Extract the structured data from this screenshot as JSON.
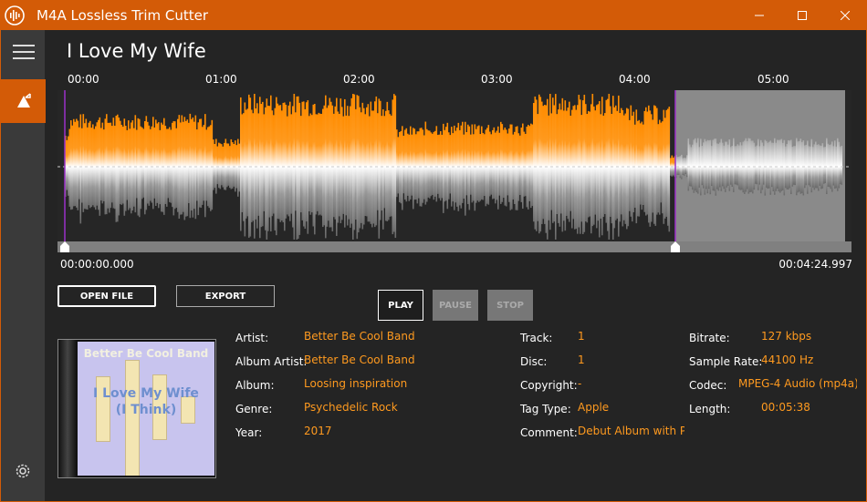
{
  "window": {
    "title": "M4A Lossless Trim Cutter",
    "minimize": "—",
    "maximize": "☐",
    "close": "✕"
  },
  "track": {
    "title": "I Love My Wife"
  },
  "timeline": {
    "ticks": [
      "00:00",
      "01:00",
      "02:00",
      "03:00",
      "04:00",
      "05:00"
    ]
  },
  "selection": {
    "start": "00:00:00.000",
    "end": "00:04:24.997"
  },
  "buttons": {
    "open_file": "OPEN FILE",
    "export": "EXPORT",
    "play": "PLAY",
    "pause": "PAUSE",
    "stop": "STOP"
  },
  "album_art": {
    "band": "Better Be Cool Band",
    "title_line1": "I Love My Wife",
    "title_line2": "(I Think)"
  },
  "metadata": {
    "col1": [
      {
        "label": "Artist:",
        "value": "Better Be Cool Band"
      },
      {
        "label": "Album Artist:",
        "value": "Better Be Cool Band"
      },
      {
        "label": "Album:",
        "value": "Loosing inspiration"
      },
      {
        "label": "Genre:",
        "value": "Psychedelic Rock"
      },
      {
        "label": "Year:",
        "value": "2017"
      }
    ],
    "col2": [
      {
        "label": "Track:",
        "value": "1"
      },
      {
        "label": "Disc:",
        "value": "1"
      },
      {
        "label": "Copyright:",
        "value": "-"
      },
      {
        "label": "Tag Type:",
        "value": "Apple"
      },
      {
        "label": "Comment:",
        "value": "Debut Album with Pro"
      }
    ],
    "col3": [
      {
        "label": "Bitrate:",
        "value": "127 kbps"
      },
      {
        "label": "Sample Rate:",
        "value": "44100 Hz"
      },
      {
        "label": "Codec:",
        "value": "MPEG-4 Audio (mp4a)"
      },
      {
        "label": "Length:",
        "value": "00:05:38"
      }
    ]
  },
  "colors": {
    "accent": "#d35b07",
    "wave_orange": "#ff8c00",
    "value_text": "#ff9a1f"
  }
}
